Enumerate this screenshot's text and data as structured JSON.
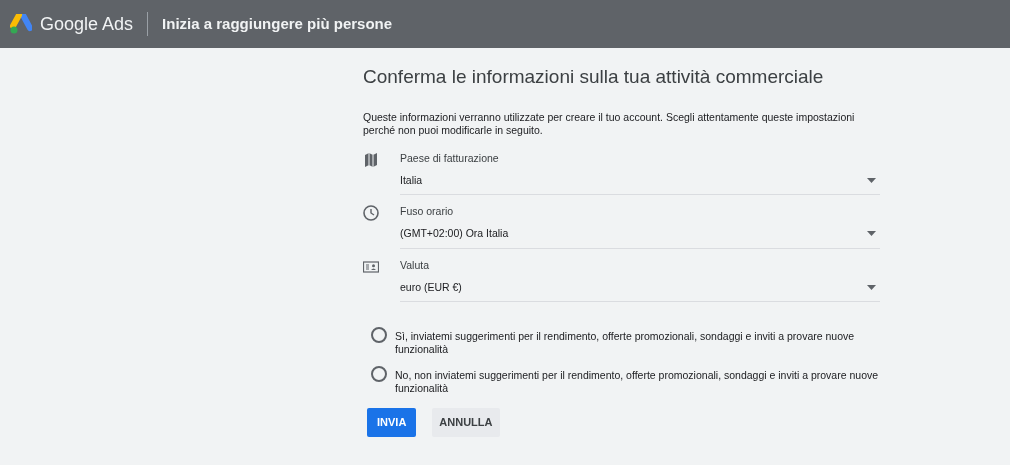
{
  "header": {
    "brand": "Google Ads",
    "title": "Inizia a raggiungere più persone"
  },
  "heading": "Conferma le informazioni sulla tua attività commerciale",
  "description": "Queste informazioni verranno utilizzate per creare il tuo account. Scegli attentamente queste impostazioni perché non puoi modificarle in seguito.",
  "fields": [
    {
      "kind": "map",
      "label": "Paese di fatturazione",
      "value": "Italia"
    },
    {
      "kind": "clock",
      "label": "Fuso orario",
      "value": "(GMT+02:00) Ora Italia"
    },
    {
      "kind": "currency",
      "label": "Valuta",
      "value": "euro (EUR €)"
    }
  ],
  "options": [
    {
      "label": "Sì, inviatemi suggerimenti per il rendimento, offerte promozionali, sondaggi e inviti a provare nuove funzionalità",
      "selected": false
    },
    {
      "label": "No, non inviatemi suggerimenti per il rendimento, offerte promozionali, sondaggi e inviti a provare nuove funzionalità",
      "selected": false
    }
  ],
  "buttons": [
    {
      "kind": "primary",
      "label": "INVIA"
    },
    {
      "kind": "secondary",
      "label": "ANNULLA"
    }
  ]
}
